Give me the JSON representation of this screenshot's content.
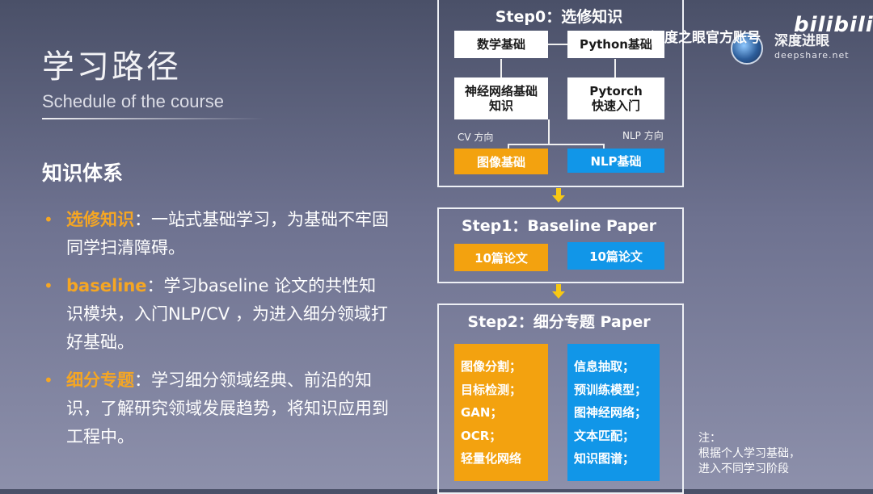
{
  "slide": {
    "title": "学习路径",
    "subtitle": "Schedule of the course",
    "section_title": "知识体系",
    "bullets": [
      {
        "highlight": "选修知识",
        "text": "：一站式基础学习，为基础不牢固同学扫清障碍。"
      },
      {
        "highlight": "baseline",
        "text": "：学习baseline 论文的共性知识模块，入门NLP/CV ，为进入细分领域打好基础。"
      },
      {
        "highlight": "细分专题",
        "text": "：学习细分领域经典、前沿的知识，了解研究领域发展趋势，将知识应用到工程中。"
      }
    ],
    "bullet_marker": "•"
  },
  "step0": {
    "title": "Step0：选修知识",
    "box_math": "数学基础",
    "box_python": "Python基础",
    "box_nn": "神经网络基础知识",
    "box_pytorch": "Pytorch快速入门",
    "cv_dir": "CV 方向",
    "nlp_dir": "NLP 方向",
    "box_image": "图像基础",
    "box_nlp": "NLP基础"
  },
  "step1": {
    "title": "Step1：Baseline Paper",
    "left": "10篇论文",
    "right": "10篇论文"
  },
  "step2": {
    "title": "Step2：细分专题 Paper",
    "left_items": [
      "图像分割；",
      "目标检测；",
      "GAN；",
      "OCR；",
      "轻量化网络"
    ],
    "right_items": [
      "信息抽取；",
      "预训练模型；",
      "图神经网络；",
      "文本匹配；",
      "知识图谱；"
    ]
  },
  "note": {
    "lines": [
      "注：",
      "根据个人学习基础，",
      "进入不同学习阶段"
    ]
  },
  "watermark": {
    "channel": "深度之眼官方账号",
    "site": "deepshare.net",
    "overlay": "深度进眼",
    "bili": "bilibili"
  },
  "colors": {
    "accent_orange": "#f3a20f",
    "accent_blue": "#1196e8",
    "arrow_yellow": "#f7c814"
  }
}
